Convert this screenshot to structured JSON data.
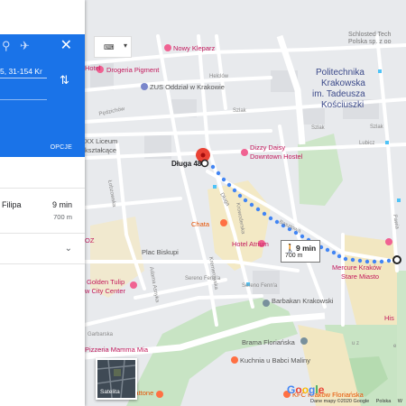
{
  "panel": {
    "bike_icon": "bicycle-icon",
    "plane_icon": "plane-icon",
    "close_label": "✕",
    "destination": "5, 31-154 Kr",
    "swap_icon": "swap-icon",
    "options_label": "OPCJE",
    "route": {
      "name": "Filipa",
      "time": "9 min",
      "distance": "700 m"
    },
    "expand_icon": "chevron-down-icon",
    "accent_color": "#1a73e8"
  },
  "map_controls": {
    "keyboard_icon": "keyboard-icon",
    "caret": "▾"
  },
  "map": {
    "top_right_label_1": "Schlosted Tech",
    "top_right_label_2": "Polska sp. z oo",
    "poi_nowy_kleparz": "Nowy Kleparz",
    "poi_hotel_top": "Hotel",
    "poi_drogeria": "Drogeria Pigment",
    "poi_zus": "ZUS Oddział w Krakowie",
    "poi_politechnika": [
      "Politechnika",
      "Krakowska",
      "im. Tadeusza",
      "Kościuszki"
    ],
    "street_helclow": "Helclów",
    "street_szlak_1": "Szlak",
    "street_szlak_2": "Szlak",
    "street_szlak_3": "Szlak",
    "street_pedzichow": "Pędzichów",
    "street_lubicz": "Lubicz",
    "street_dluga_side": "Długa",
    "street_lobzowska": "Łobzowska",
    "street_sereno_fenna": "Sereno Fenn'a",
    "street_sereno_fenna_2": "Sereno Fenn'a",
    "street_kremerowska": "Kremerowska",
    "street_basztowa": "Basztowa",
    "street_pawia": "Pawia",
    "street_adama_asnyka": "Adama Asnyka",
    "street_garbarska": "Garbarska",
    "street_krowoderska": "Krowoderska",
    "poi_liceum": [
      "XX Liceum",
      "kształcące"
    ],
    "poi_dizzy": [
      "Dizzy Daisy",
      "Downtown Hostel"
    ],
    "marker_label": "Długa 48",
    "poi_chata": "Chata",
    "poi_hotel_atrium": "Hotel Atrium",
    "poi_plac_biskupi": "Plac Biskupi",
    "poi_oz": "OZ",
    "poi_golden_tulip": [
      "Golden Tulip",
      "w City Center"
    ],
    "poi_mercure": [
      "Mercure Kraków",
      "Stare Miasto"
    ],
    "poi_barbakan": "Barbakan Krakowski",
    "poi_brama": "Brama Floriańska",
    "poi_kuchnia": "Kuchnia u Babci Maliny",
    "poi_mamma_mia": "Pizzeria Mamma Mia",
    "poi_kfc": "KFC Kraków Floriańska",
    "poi_his": "His",
    "poi_cattone": "Cattone",
    "poi_uz": "u z",
    "poi_e": "e",
    "route_info": {
      "walk_icon": "walking-icon",
      "time": "9 min",
      "distance": "700 m"
    },
    "route_color": "#4285f4",
    "marker_color": "#ea4335"
  },
  "satellite_label": "Satelita",
  "google_logo": {
    "letters": [
      "G",
      "o",
      "o",
      "g",
      "l",
      "e"
    ],
    "colors": [
      "#4285f4",
      "#ea4335",
      "#fbbc05",
      "#4285f4",
      "#34a853",
      "#ea4335"
    ]
  },
  "attribution": {
    "data": "Dane mapy ©2020 Google",
    "country": "Polska",
    "terms": "W"
  }
}
